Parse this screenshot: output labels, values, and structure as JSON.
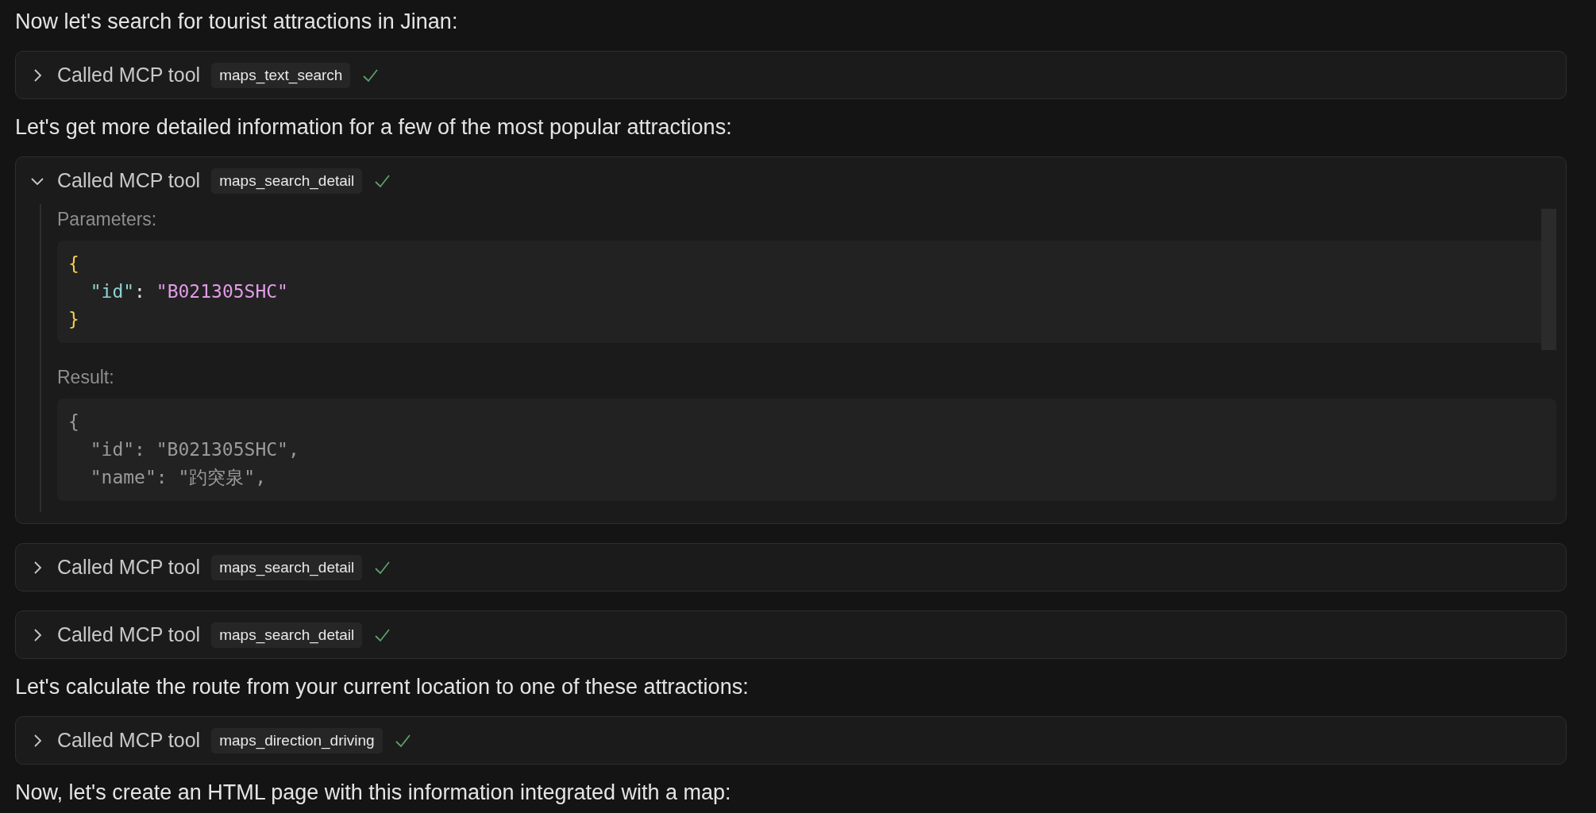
{
  "messages": [
    {
      "kind": "text",
      "text": "Now let's search for tourist attractions in Jinan:"
    },
    {
      "kind": "tool_call",
      "label": "Called MCP tool",
      "tool": "maps_text_search",
      "expanded": false,
      "done": true
    },
    {
      "kind": "text",
      "text": "Let's get more detailed information for a few of the most popular attractions:"
    },
    {
      "kind": "tool_call",
      "label": "Called MCP tool",
      "tool": "maps_search_detail",
      "expanded": true,
      "done": true,
      "parameters": {
        "label": "Parameters:",
        "lines": [
          [
            {
              "kind": "brace",
              "text": "{"
            }
          ],
          [
            {
              "kind": "key",
              "text": "  \"id\""
            },
            {
              "kind": "punct",
              "text": ": "
            },
            {
              "kind": "string",
              "text": "\"B021305SHC\""
            }
          ],
          [
            {
              "kind": "brace",
              "text": "}"
            }
          ]
        ]
      },
      "result": {
        "label": "Result:",
        "lines": [
          [
            {
              "kind": "plain",
              "text": "{"
            }
          ],
          [
            {
              "kind": "plain",
              "text": "  \"id\": \"B021305SHC\","
            }
          ],
          [
            {
              "kind": "plain",
              "text": "  \"name\": \"趵突泉\","
            }
          ]
        ]
      }
    },
    {
      "kind": "tool_call",
      "label": "Called MCP tool",
      "tool": "maps_search_detail",
      "expanded": false,
      "done": true
    },
    {
      "kind": "tool_call",
      "label": "Called MCP tool",
      "tool": "maps_search_detail",
      "expanded": false,
      "done": true
    },
    {
      "kind": "text",
      "text": "Let's calculate the route from your current location to one of these attractions:"
    },
    {
      "kind": "tool_call",
      "label": "Called MCP tool",
      "tool": "maps_direction_driving",
      "expanded": false,
      "done": true
    },
    {
      "kind": "text",
      "text": "Now, let's create an HTML page with this information integrated with a map:"
    }
  ]
}
